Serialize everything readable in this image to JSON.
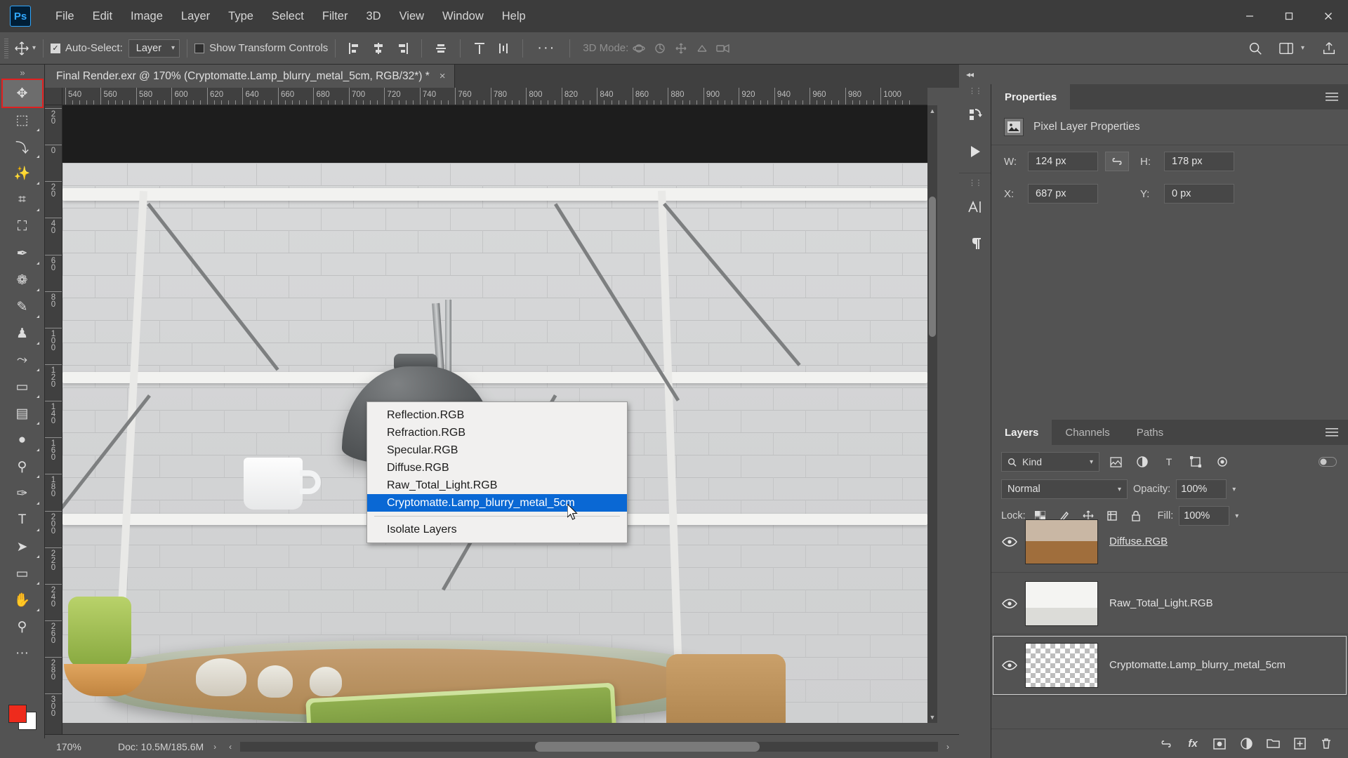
{
  "app": {
    "logo_text": "Ps",
    "menus": [
      "File",
      "Edit",
      "Image",
      "Layer",
      "Type",
      "Select",
      "Filter",
      "3D",
      "View",
      "Window",
      "Help"
    ],
    "window_controls": {
      "minimize": "minimize-icon",
      "maximize": "maximize-icon",
      "close": "close-icon"
    }
  },
  "options_bar": {
    "move_tool_icon": "move-tool-icon",
    "auto_select_label": "Auto-Select:",
    "auto_select_checked": true,
    "auto_select_value": "Layer",
    "show_transform_label": "Show Transform Controls",
    "show_transform_checked": false,
    "align_icons": [
      "align-left-edges-icon",
      "align-horizontal-centers-icon",
      "align-right-edges-icon",
      "align-vertical-centers-icon"
    ],
    "distribute_icons": [
      "distribute-top-edges-icon",
      "distribute-vertical-centers-icon"
    ],
    "more_label": "···",
    "mode_3d_label": "3D Mode:",
    "mode_3d_icons": [
      "orbit-3d-icon",
      "roll-3d-icon",
      "pan-3d-icon",
      "slide-3d-icon",
      "zoom-3d-icon"
    ],
    "right_icons": [
      "search-icon",
      "workspace-icon",
      "share-icon"
    ]
  },
  "document": {
    "tab_title": "Final Render.exr @ 170% (Cryptomatte.Lamp_blurry_metal_5cm, RGB/32*) *",
    "close_glyph": "×"
  },
  "rulers": {
    "horizontal_ticks": [
      "540",
      "560",
      "580",
      "600",
      "620",
      "640",
      "660",
      "680",
      "700",
      "720",
      "740",
      "760",
      "780",
      "800",
      "820",
      "840",
      "860",
      "880",
      "900",
      "920",
      "940",
      "960",
      "980",
      "1000"
    ],
    "vertical_ticks": [
      "20",
      "0",
      "20",
      "40",
      "60",
      "80",
      "100",
      "120",
      "140",
      "160",
      "180",
      "200",
      "220",
      "240",
      "260",
      "280",
      "300"
    ]
  },
  "toolbar": {
    "grip": "»",
    "tools": [
      {
        "name": "move-tool",
        "glyph": "✥",
        "selected": true,
        "corner": false
      },
      {
        "name": "rectangular-marquee-tool",
        "glyph": "⬚",
        "selected": false,
        "corner": true
      },
      {
        "name": "lasso-tool",
        "glyph": "⤵",
        "selected": false,
        "corner": true
      },
      {
        "name": "quick-selection-tool",
        "glyph": "✨",
        "selected": false,
        "corner": true
      },
      {
        "name": "crop-tool",
        "glyph": "⌗",
        "selected": false,
        "corner": true
      },
      {
        "name": "frame-tool",
        "glyph": "⛶",
        "selected": false,
        "corner": false
      },
      {
        "name": "eyedropper-tool",
        "glyph": "✒",
        "selected": false,
        "corner": true
      },
      {
        "name": "spot-healing-brush-tool",
        "glyph": "❁",
        "selected": false,
        "corner": true
      },
      {
        "name": "brush-tool",
        "glyph": "✎",
        "selected": false,
        "corner": true
      },
      {
        "name": "clone-stamp-tool",
        "glyph": "♟",
        "selected": false,
        "corner": true
      },
      {
        "name": "history-brush-tool",
        "glyph": "⤳",
        "selected": false,
        "corner": true
      },
      {
        "name": "eraser-tool",
        "glyph": "▭",
        "selected": false,
        "corner": true
      },
      {
        "name": "gradient-tool",
        "glyph": "▤",
        "selected": false,
        "corner": true
      },
      {
        "name": "blur-tool",
        "glyph": "●",
        "selected": false,
        "corner": true
      },
      {
        "name": "dodge-tool",
        "glyph": "⚲",
        "selected": false,
        "corner": true
      },
      {
        "name": "pen-tool",
        "glyph": "✑",
        "selected": false,
        "corner": true
      },
      {
        "name": "type-tool",
        "glyph": "T",
        "selected": false,
        "corner": true
      },
      {
        "name": "path-selection-tool",
        "glyph": "➤",
        "selected": false,
        "corner": true
      },
      {
        "name": "rectangle-tool",
        "glyph": "▭",
        "selected": false,
        "corner": true
      },
      {
        "name": "hand-tool",
        "glyph": "✋",
        "selected": false,
        "corner": true
      },
      {
        "name": "zoom-tool",
        "glyph": "⚲",
        "selected": false,
        "corner": false
      },
      {
        "name": "edit-toolbar",
        "glyph": "···",
        "selected": false,
        "corner": false
      }
    ],
    "foreground_color": "#ee2b1c",
    "background_color": "#ffffff"
  },
  "context_menu": {
    "items": [
      {
        "label": "Reflection.RGB",
        "selected": false
      },
      {
        "label": "Refraction.RGB",
        "selected": false
      },
      {
        "label": "Specular.RGB",
        "selected": false
      },
      {
        "label": "Diffuse.RGB",
        "selected": false
      },
      {
        "label": "Raw_Total_Light.RGB",
        "selected": false
      },
      {
        "label": "Cryptomatte.Lamp_blurry_metal_5cm",
        "selected": true
      }
    ],
    "footer_item": "Isolate Layers",
    "highlight_color": "#0a68d4"
  },
  "status_bar": {
    "zoom": "170%",
    "doc_info": "Doc: 10.5M/185.6M",
    "chevron": "›"
  },
  "dock": {
    "collapse_glyph": "◂◂",
    "rail_icons": [
      "libraries-icon",
      "actions-play-icon",
      "character-icon",
      "paragraph-icon"
    ]
  },
  "properties_panel": {
    "tabs": [
      {
        "label": "Properties",
        "active": true
      }
    ],
    "menu_glyph": "≡",
    "header_title": "Pixel Layer Properties",
    "header_icon": "image-layer-icon",
    "fields": {
      "w_label": "W:",
      "w_value": "124 px",
      "h_label": "H:",
      "h_value": "178 px",
      "x_label": "X:",
      "x_value": "687 px",
      "y_label": "Y:",
      "y_value": "0 px",
      "link_glyph": "⚭"
    }
  },
  "layers_panel": {
    "tabs": [
      {
        "label": "Layers",
        "active": true
      },
      {
        "label": "Channels",
        "active": false
      },
      {
        "label": "Paths",
        "active": false
      }
    ],
    "menu_glyph": "≡",
    "filter": {
      "search_icon": "search-icon",
      "kind_label": "Kind",
      "chevron": "⌄",
      "type_icons": [
        "filter-pixel-icon",
        "filter-adjustment-icon",
        "filter-type-icon",
        "filter-shape-icon",
        "filter-smart-icon"
      ],
      "toggle_icon": "filter-toggle-icon"
    },
    "blend_mode": "Normal",
    "opacity_label": "Opacity:",
    "opacity_value": "100%",
    "lock_label": "Lock:",
    "lock_icons": [
      "lock-transparent-pixels-icon",
      "lock-image-pixels-icon",
      "lock-position-icon",
      "lock-artboard-icon",
      "lock-all-icon"
    ],
    "fill_label": "Fill:",
    "fill_value": "100%",
    "layers": [
      {
        "name": "Diffuse.RGB",
        "visible": true,
        "thumb": "scene-thumb",
        "underlined": true,
        "selected": false
      },
      {
        "name": "Raw_Total_Light.RGB",
        "visible": true,
        "thumb": "scene-thumb-light",
        "underlined": false,
        "selected": false
      },
      {
        "name": "Cryptomatte.Lamp_blurry_metal_5cm",
        "visible": true,
        "thumb": "transparent-thumb",
        "underlined": false,
        "selected": true
      }
    ],
    "footer_icons": [
      "link-layers-icon",
      "layer-style-icon",
      "layer-mask-icon",
      "adjustment-layer-icon",
      "new-group-icon",
      "new-layer-icon",
      "delete-layer-icon"
    ],
    "footer_glyphs": [
      "⚭",
      "fx",
      "▣",
      "◑",
      "▱",
      "⊞",
      "Ὕ1"
    ]
  }
}
